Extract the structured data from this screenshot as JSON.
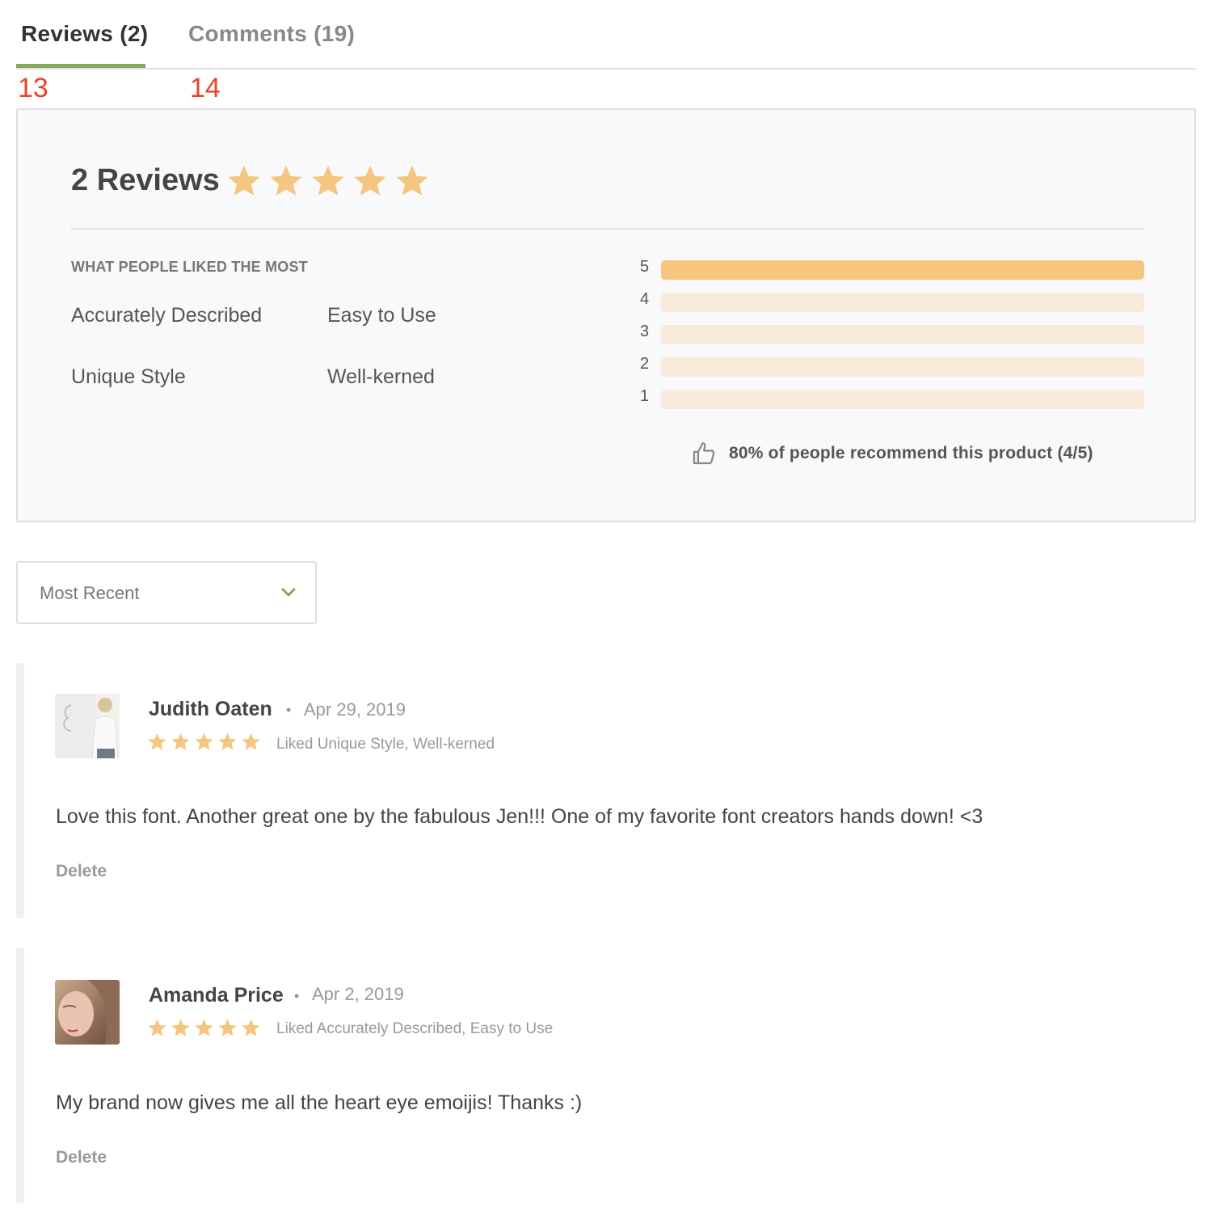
{
  "tabs": {
    "reviews_label": "Reviews (2)",
    "comments_label": "Comments (19)",
    "reviews_badge": "13",
    "comments_badge": "14"
  },
  "summary": {
    "title": "2 Reviews",
    "average_rating": 5,
    "liked_heading": "WHAT PEOPLE LIKED THE MOST",
    "liked": [
      "Accurately Described",
      "Easy to Use",
      "Unique Style",
      "Well-kerned"
    ],
    "distribution": [
      {
        "stars": "5",
        "fraction": 1.0
      },
      {
        "stars": "4",
        "fraction": 0
      },
      {
        "stars": "3",
        "fraction": 0
      },
      {
        "stars": "2",
        "fraction": 0
      },
      {
        "stars": "1",
        "fraction": 0
      }
    ],
    "recommend_text": "80% of people recommend this product (4/5)"
  },
  "sort": {
    "selected": "Most Recent"
  },
  "reviews": [
    {
      "name": "Judith Oaten",
      "date": "Apr 29, 2019",
      "rating": 5,
      "liked": "Liked Unique Style, Well-kerned",
      "body": "Love this font. Another great one by the fabulous Jen!!! One of my favorite font creators hands down! <3",
      "delete_label": "Delete"
    },
    {
      "name": "Amanda Price",
      "date": "Apr 2, 2019",
      "rating": 5,
      "liked": "Liked Accurately Described, Easy to Use",
      "body": "My brand now gives me all the heart eye emoijis! Thanks :)",
      "delete_label": "Delete"
    }
  ],
  "colors": {
    "accent_green": "#8aa65a",
    "star_gold": "#f5c680",
    "bar_track": "#f7ebdc",
    "badge_red": "#e8432a"
  }
}
